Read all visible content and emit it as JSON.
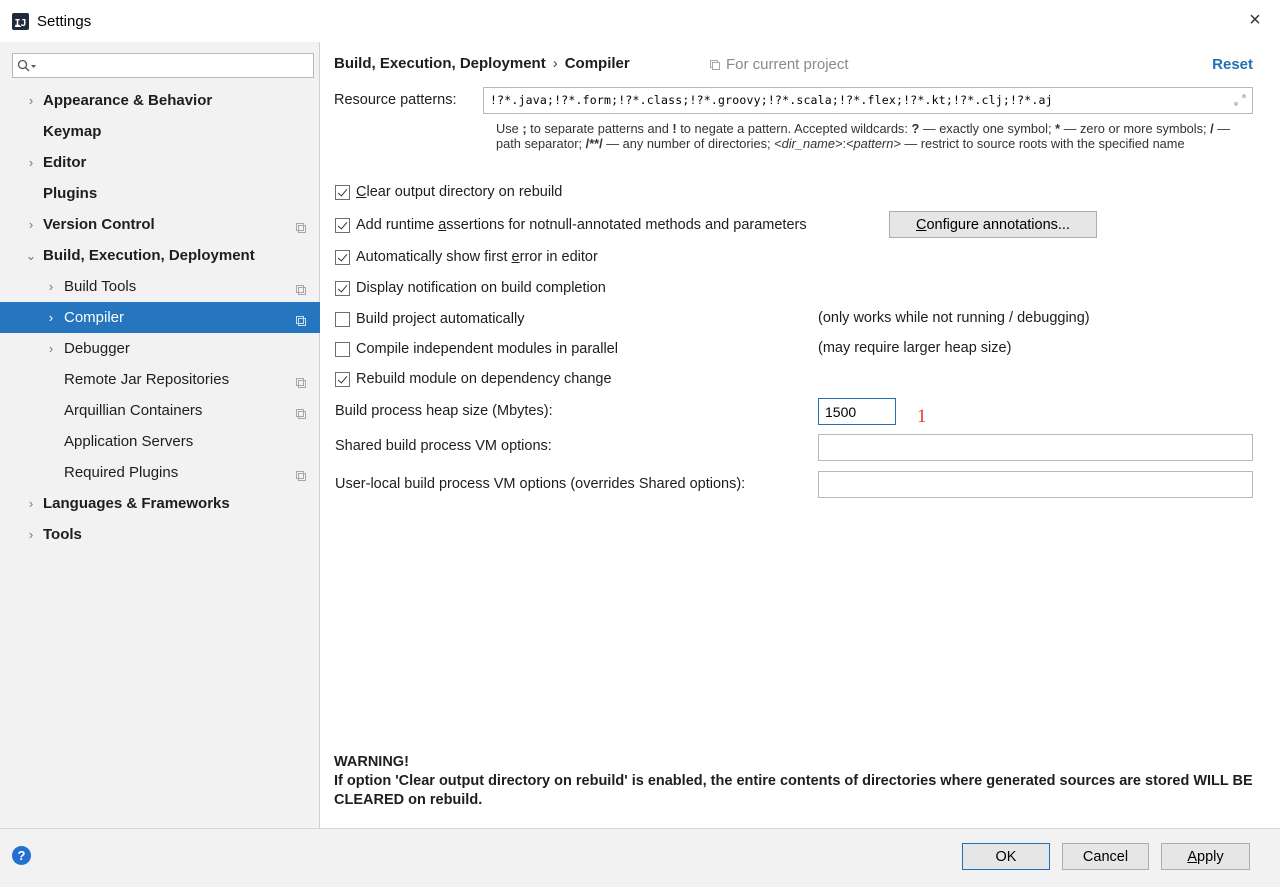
{
  "window": {
    "title": "Settings",
    "icon": "intellij-app-icon",
    "close": "×"
  },
  "search": {
    "placeholder": "",
    "value": "",
    "icon": "search-icon"
  },
  "sidebar": {
    "items": [
      {
        "label": "Appearance & Behavior",
        "bold": true,
        "chevron": "›",
        "indent": 0
      },
      {
        "label": "Keymap",
        "bold": true,
        "chevron": "",
        "indent": 0
      },
      {
        "label": "Editor",
        "bold": true,
        "chevron": "›",
        "indent": 0
      },
      {
        "label": "Plugins",
        "bold": true,
        "chevron": "",
        "indent": 0
      },
      {
        "label": "Version Control",
        "bold": true,
        "chevron": "›",
        "indent": 0,
        "project_icon": true
      },
      {
        "label": "Build, Execution, Deployment",
        "bold": true,
        "chevron": "⌄",
        "indent": 0
      },
      {
        "label": "Build Tools",
        "bold": false,
        "chevron": "›",
        "indent": 1,
        "project_icon": true
      },
      {
        "label": "Compiler",
        "bold": false,
        "chevron": "›",
        "indent": 1,
        "project_icon": true,
        "selected": true
      },
      {
        "label": "Debugger",
        "bold": false,
        "chevron": "›",
        "indent": 1
      },
      {
        "label": "Remote Jar Repositories",
        "bold": false,
        "chevron": "",
        "indent": 1,
        "project_icon": true
      },
      {
        "label": "Arquillian Containers",
        "bold": false,
        "chevron": "",
        "indent": 1,
        "project_icon": true
      },
      {
        "label": "Application Servers",
        "bold": false,
        "chevron": "",
        "indent": 1
      },
      {
        "label": "Required Plugins",
        "bold": false,
        "chevron": "",
        "indent": 1,
        "project_icon": true
      },
      {
        "label": "Languages & Frameworks",
        "bold": true,
        "chevron": "›",
        "indent": 0
      },
      {
        "label": "Tools",
        "bold": true,
        "chevron": "›",
        "indent": 0
      }
    ]
  },
  "header": {
    "breadcrumb_parent": "Build, Execution, Deployment",
    "breadcrumb_sep": "›",
    "breadcrumb_current": "Compiler",
    "scope": "For current project",
    "reset": "Reset"
  },
  "resource": {
    "label": "Resource patterns:",
    "value": "!?*.java;!?*.form;!?*.class;!?*.groovy;!?*.scala;!?*.flex;!?*.kt;!?*.clj;!?*.aj",
    "help_parts": {
      "p1": "Use ",
      "p2": ";",
      "p3": " to separate patterns and ",
      "p4": "!",
      "p5": " to negate a pattern. Accepted wildcards: ",
      "p6": "?",
      "p7": " — exactly one symbol; ",
      "p8": "*",
      "p9": " — zero or more symbols; ",
      "p10": "/",
      "p11": " — path separator; ",
      "p12": "/**/",
      "p13": " — any number of directories; ",
      "p14": "<dir_name>",
      "p15": ":",
      "p16": "<pattern>",
      "p17": " — restrict to source roots with the specified name"
    }
  },
  "options": {
    "clear_output": {
      "before": "",
      "mnemonic": "C",
      "after": "lear output directory on rebuild",
      "checked": true
    },
    "runtime_assertions": {
      "before": "Add runtime ",
      "mnemonic": "a",
      "after": "ssertions for notnull-annotated methods and parameters",
      "checked": true
    },
    "configure_btn": {
      "before": "",
      "mnemonic": "C",
      "after": "onfigure annotations..."
    },
    "show_first_error": {
      "before": "Automatically show first ",
      "mnemonic": "e",
      "after": "rror in editor",
      "checked": true
    },
    "display_notification": {
      "label": "Display notification on build completion",
      "checked": true
    },
    "build_auto": {
      "label": "Build project automatically",
      "checked": false,
      "note": "(only works while not running / debugging)"
    },
    "compile_parallel": {
      "label": "Compile independent modules in parallel",
      "checked": false,
      "note": "(may require larger heap size)"
    },
    "rebuild_module": {
      "label": "Rebuild module on dependency change",
      "checked": true
    }
  },
  "heap": {
    "label": "Build process heap size (Mbytes):",
    "value": "1500",
    "annotation": "1"
  },
  "shared_vm": {
    "label": "Shared build process VM options:",
    "value": ""
  },
  "user_vm": {
    "label": "User-local build process VM options (overrides Shared options):",
    "value": ""
  },
  "warning": {
    "title": "WARNING!",
    "text": "If option 'Clear output directory on rebuild' is enabled, the entire contents of directories where generated sources are stored WILL BE CLEARED on rebuild."
  },
  "footer": {
    "help": "?",
    "ok": "OK",
    "cancel": "Cancel",
    "apply_mnemonic": "A",
    "apply_rest": "pply"
  },
  "colors": {
    "accent": "#2675bf",
    "link": "#2470b3",
    "annotation": "#e23a2a",
    "sidebar_bg": "#f2f2f2"
  }
}
